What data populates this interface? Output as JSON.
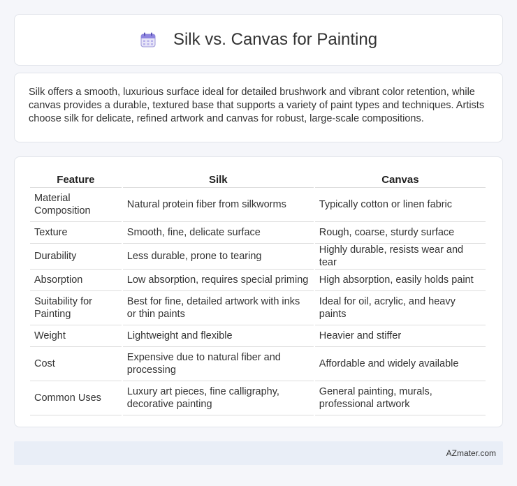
{
  "header": {
    "title": "Silk vs. Canvas for Painting",
    "icon": "calendar-icon"
  },
  "intro": {
    "text": "Silk offers a smooth, luxurious surface ideal for detailed brushwork and vibrant color retention, while canvas provides a durable, textured base that supports a variety of paint types and techniques. Artists choose silk for delicate, refined artwork and canvas for robust, large-scale compositions."
  },
  "table": {
    "headers": [
      "Feature",
      "Silk",
      "Canvas"
    ],
    "rows": [
      {
        "feature": "Material Composition",
        "silk": "Natural protein fiber from silkworms",
        "canvas": "Typically cotton or linen fabric"
      },
      {
        "feature": "Texture",
        "silk": "Smooth, fine, delicate surface",
        "canvas": "Rough, coarse, sturdy surface"
      },
      {
        "feature": "Durability",
        "silk": "Less durable, prone to tearing",
        "canvas": "Highly durable, resists wear and tear"
      },
      {
        "feature": "Absorption",
        "silk": "Low absorption, requires special priming",
        "canvas": "High absorption, easily holds paint"
      },
      {
        "feature": "Suitability for Painting",
        "silk": "Best for fine, detailed artwork with inks or thin paints",
        "canvas": "Ideal for oil, acrylic, and heavy paints"
      },
      {
        "feature": "Weight",
        "silk": "Lightweight and flexible",
        "canvas": "Heavier and stiffer"
      },
      {
        "feature": "Cost",
        "silk": "Expensive due to natural fiber and processing",
        "canvas": "Affordable and widely available"
      },
      {
        "feature": "Common Uses",
        "silk": "Luxury art pieces, fine calligraphy, decorative painting",
        "canvas": "General painting, murals, professional artwork"
      }
    ]
  },
  "footer": {
    "text": "AZmater.com"
  }
}
